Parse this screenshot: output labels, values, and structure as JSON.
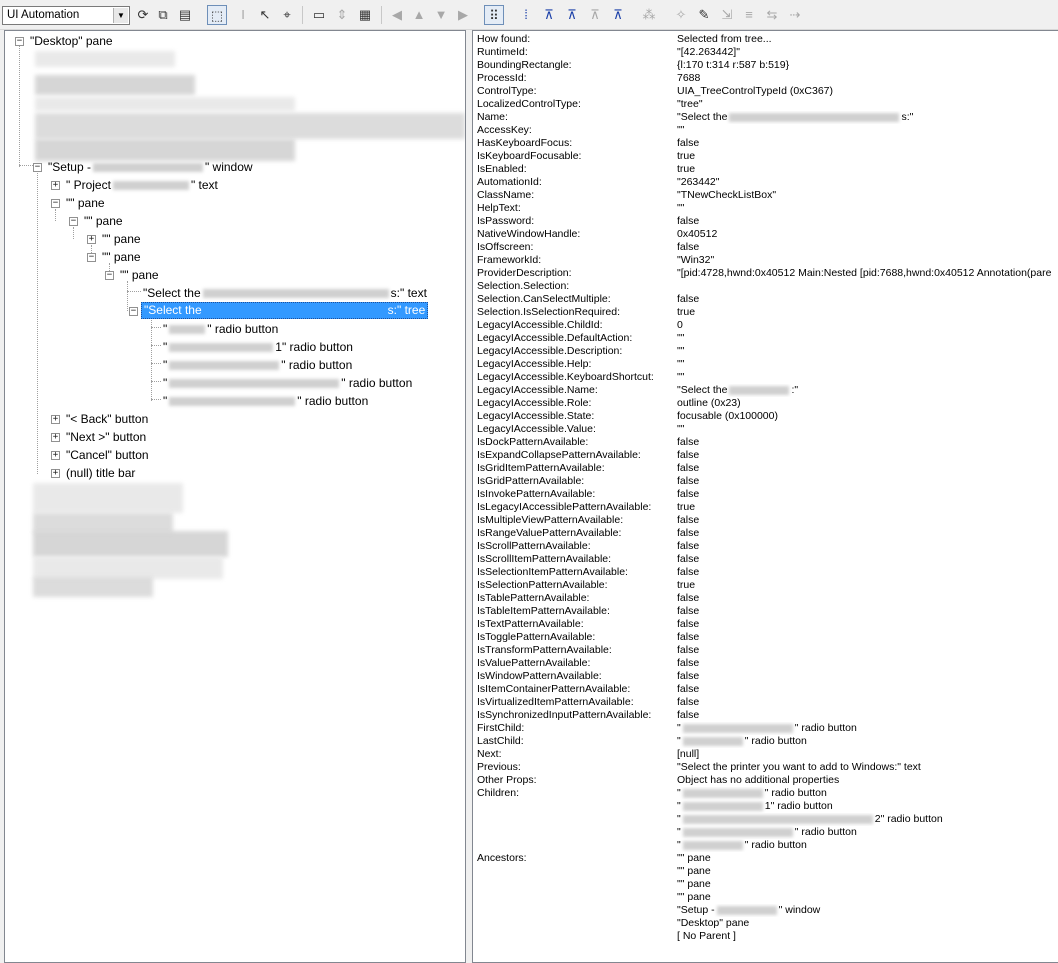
{
  "toolbar": {
    "mode_select": "UI Automation",
    "icons": [
      "refresh-icon",
      "copy-icon",
      "properties-icon",
      "highlight-rect-icon",
      "text-cursor-icon",
      "select-pointer-icon",
      "focus-tracking-icon",
      "window-icon",
      "caret-icon",
      "hover-icon",
      "back-arrow-icon",
      "up-arrow-icon",
      "down-arrow-icon",
      "forward-arrow-icon",
      "tree-view-icon",
      "parent-icon",
      "first-child-icon",
      "next-sibling-icon",
      "prev-sibling-icon",
      "last-child-icon",
      "navigation-icon",
      "action-icon",
      "pattern-icon",
      "expand-icon",
      "collapse-icon",
      "sort-icon",
      "settings-icon"
    ]
  },
  "tree": {
    "desktop": "\"Desktop\" pane",
    "setup_prefix": "\"Setup -",
    "setup_suffix": "\" window",
    "project_prefix": "\" Project",
    "project_suffix": "\" text",
    "pane_empty_1": "\"\" pane",
    "pane_empty_2": "\"\" pane",
    "pane_empty_3": "\"\" pane",
    "pane_empty_4": "\"\" pane",
    "pane_empty_5": "\"\" pane",
    "select_text_prefix": "\"Select the",
    "select_text_suffix": "s:\" text",
    "selected_prefix": "\"Select the",
    "selected_suffix": "s:\" tree",
    "radio_1_prefix": "\"",
    "radio_1_suffix": "\" radio button",
    "radio_2_prefix": "\"",
    "radio_2_suffix": "1\" radio button",
    "radio_3_prefix": "\"",
    "radio_3_suffix": "\" radio button",
    "radio_4_prefix": "\"",
    "radio_4_suffix": "\" radio button",
    "radio_5_prefix": "\"",
    "radio_5_suffix": "\" radio button",
    "back_button": "\"< Back\" button",
    "next_button": "\"Next >\" button",
    "cancel_button": "\"Cancel\" button",
    "title_bar": "(null) title bar"
  },
  "properties": [
    {
      "name": "How found:",
      "value": "Selected from tree..."
    },
    {
      "name": "RuntimeId:",
      "value": "\"[42.263442]\""
    },
    {
      "name": "BoundingRectangle:",
      "value": "{l:170 t:314 r:587 b:519}"
    },
    {
      "name": "ProcessId:",
      "value": "7688"
    },
    {
      "name": "ControlType:",
      "value": "UIA_TreeControlTypeId (0xC367)"
    },
    {
      "name": "LocalizedControlType:",
      "value": "\"tree\""
    },
    {
      "name": "Name:",
      "value": "\"Select the",
      "value_suffix": "s:\""
    },
    {
      "name": "AccessKey:",
      "value": "\"\""
    },
    {
      "name": "HasKeyboardFocus:",
      "value": "false"
    },
    {
      "name": "IsKeyboardFocusable:",
      "value": "true"
    },
    {
      "name": "IsEnabled:",
      "value": "true"
    },
    {
      "name": "AutomationId:",
      "value": "\"263442\""
    },
    {
      "name": "ClassName:",
      "value": "\"TNewCheckListBox\""
    },
    {
      "name": "HelpText:",
      "value": "\"\""
    },
    {
      "name": "IsPassword:",
      "value": "false"
    },
    {
      "name": "NativeWindowHandle:",
      "value": "0x40512"
    },
    {
      "name": "IsOffscreen:",
      "value": "false"
    },
    {
      "name": "FrameworkId:",
      "value": "\"Win32\""
    },
    {
      "name": "ProviderDescription:",
      "value": "\"[pid:4728,hwnd:0x40512 Main:Nested [pid:7688,hwnd:0x40512 Annotation(pare"
    },
    {
      "name": "Selection.Selection:",
      "value": ""
    },
    {
      "name": "Selection.CanSelectMultiple:",
      "value": "false"
    },
    {
      "name": "Selection.IsSelectionRequired:",
      "value": "true"
    },
    {
      "name": "LegacyIAccessible.ChildId:",
      "value": "0"
    },
    {
      "name": "LegacyIAccessible.DefaultAction:",
      "value": "\"\""
    },
    {
      "name": "LegacyIAccessible.Description:",
      "value": "\"\""
    },
    {
      "name": "LegacyIAccessible.Help:",
      "value": "\"\""
    },
    {
      "name": "LegacyIAccessible.KeyboardShortcut:",
      "value": "\"\""
    },
    {
      "name": "LegacyIAccessible.Name:",
      "value": "\"Select the",
      "value_suffix": ":\""
    },
    {
      "name": "LegacyIAccessible.Role:",
      "value": "outline (0x23)"
    },
    {
      "name": "LegacyIAccessible.State:",
      "value": "focusable (0x100000)"
    },
    {
      "name": "LegacyIAccessible.Value:",
      "value": "\"\""
    },
    {
      "name": "IsDockPatternAvailable:",
      "value": "false"
    },
    {
      "name": "IsExpandCollapsePatternAvailable:",
      "value": "false"
    },
    {
      "name": "IsGridItemPatternAvailable:",
      "value": "false"
    },
    {
      "name": "IsGridPatternAvailable:",
      "value": "false"
    },
    {
      "name": "IsInvokePatternAvailable:",
      "value": "false"
    },
    {
      "name": "IsLegacyIAccessiblePatternAvailable:",
      "value": "true"
    },
    {
      "name": "IsMultipleViewPatternAvailable:",
      "value": "false"
    },
    {
      "name": "IsRangeValuePatternAvailable:",
      "value": "false"
    },
    {
      "name": "IsScrollPatternAvailable:",
      "value": "false"
    },
    {
      "name": "IsScrollItemPatternAvailable:",
      "value": "false"
    },
    {
      "name": "IsSelectionItemPatternAvailable:",
      "value": "false"
    },
    {
      "name": "IsSelectionPatternAvailable:",
      "value": "true"
    },
    {
      "name": "IsTablePatternAvailable:",
      "value": "false"
    },
    {
      "name": "IsTableItemPatternAvailable:",
      "value": "false"
    },
    {
      "name": "IsTextPatternAvailable:",
      "value": "false"
    },
    {
      "name": "IsTogglePatternAvailable:",
      "value": "false"
    },
    {
      "name": "IsTransformPatternAvailable:",
      "value": "false"
    },
    {
      "name": "IsValuePatternAvailable:",
      "value": "false"
    },
    {
      "name": "IsWindowPatternAvailable:",
      "value": "false"
    },
    {
      "name": "IsItemContainerPatternAvailable:",
      "value": "false"
    },
    {
      "name": "IsVirtualizedItemPatternAvailable:",
      "value": "false"
    },
    {
      "name": "IsSynchronizedInputPatternAvailable:",
      "value": "false"
    },
    {
      "name": "FirstChild:",
      "value": "\"",
      "value_suffix": "\" radio button"
    },
    {
      "name": "LastChild:",
      "value": "\"",
      "value_suffix": "\" radio button"
    },
    {
      "name": "Next:",
      "value": "[null]"
    },
    {
      "name": "Previous:",
      "value": "\"Select the printer you want to add to Windows:\" text"
    },
    {
      "name": "Other Props:",
      "value": "Object has no additional properties"
    },
    {
      "name": "Children:",
      "value": "\"",
      "value_suffix": "\" radio button"
    },
    {
      "name": "",
      "value": "\"",
      "value_suffix": "1\" radio button"
    },
    {
      "name": "",
      "value": "\"",
      "value_suffix": "2\" radio button"
    },
    {
      "name": "",
      "value": "\"",
      "value_suffix": "\" radio button"
    },
    {
      "name": "",
      "value": "\"",
      "value_suffix": "\" radio button"
    },
    {
      "name": "Ancestors:",
      "value": "\"\" pane"
    },
    {
      "name": "",
      "value": "\"\" pane"
    },
    {
      "name": "",
      "value": "\"\" pane"
    },
    {
      "name": "",
      "value": "\"\" pane"
    },
    {
      "name": "",
      "value": "\"Setup -",
      "value_suffix": "\" window"
    },
    {
      "name": "",
      "value": "\"Desktop\" pane"
    },
    {
      "name": "",
      "value": "[ No Parent ]"
    }
  ]
}
